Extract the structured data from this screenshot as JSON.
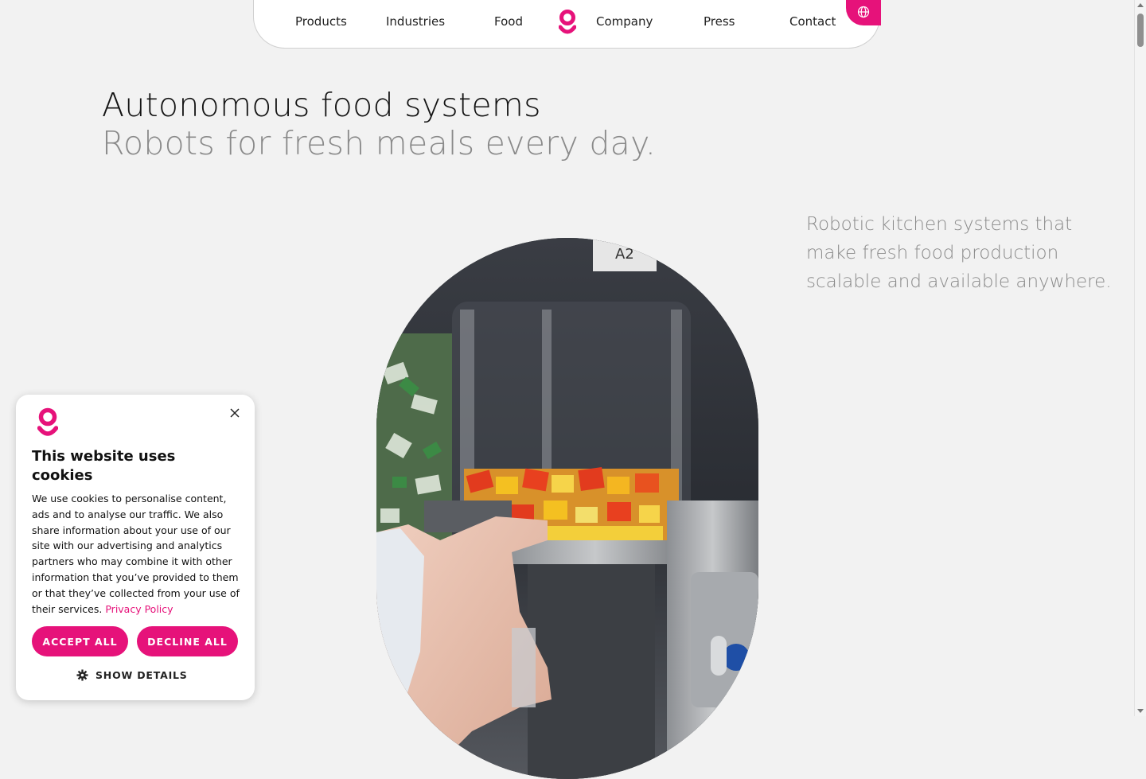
{
  "nav": {
    "items": [
      {
        "label": "Products"
      },
      {
        "label": "Industries"
      },
      {
        "label": "Food"
      },
      {
        "label": "Company"
      },
      {
        "label": "Press"
      },
      {
        "label": "Contact"
      }
    ],
    "logo_icon": "brand-logo-icon",
    "language_icon": "globe-icon"
  },
  "hero": {
    "title": "Autonomous food systems",
    "subtitle": "Robots for fresh meals every day.",
    "description": "Robotic kitchen systems that make fresh food production scalable and available anywhere."
  },
  "cookie": {
    "title": "This website uses cookies",
    "body": "We use cookies to personalise content, ads and to analyse our traffic. We also share information about your use of our site with our advertising and analytics partners who may combine it with other information that you’ve provided to them or that they’ve collected from your use of their services.",
    "privacy_link": "Privacy Policy",
    "accept_label": "ACCEPT ALL",
    "decline_label": "DECLINE ALL",
    "details_label": "SHOW DETAILS",
    "close_icon": "close-icon",
    "details_icon": "gear-icon"
  },
  "colors": {
    "accent": "#e6127a",
    "background": "#f2f2f2",
    "muted_text": "#8a8a8a"
  }
}
